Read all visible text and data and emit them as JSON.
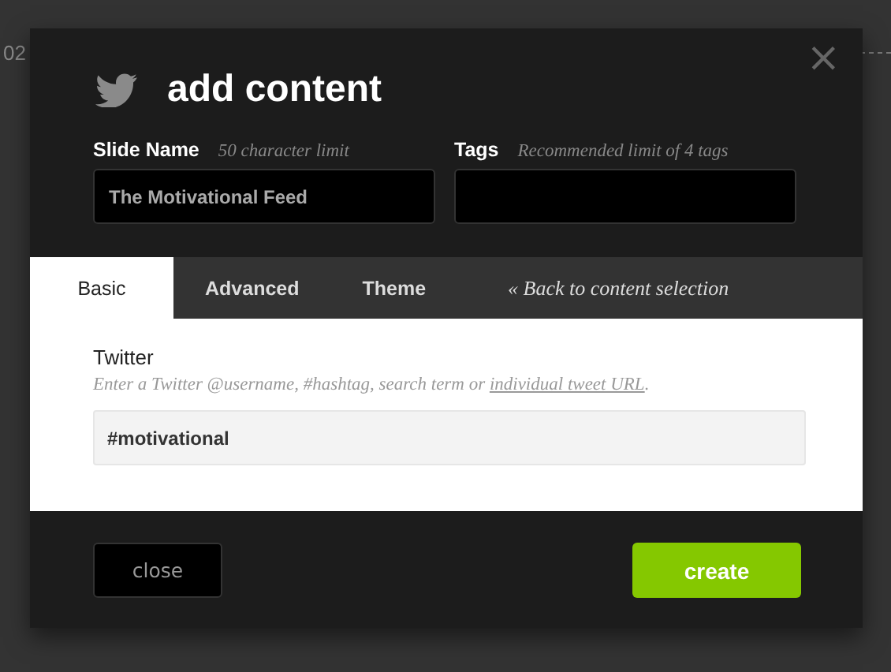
{
  "background_text": "02",
  "dialog": {
    "title": "add content",
    "close_glyph": "×",
    "fields": [
      {
        "label": "Slide Name",
        "hint": "50 character limit",
        "value": "The Motivational Feed"
      },
      {
        "label": "Tags",
        "hint": "Recommended limit of 4 tags"
      }
    ],
    "tabs": [
      {
        "label": "Basic",
        "selected": true,
        "kind": "tab"
      },
      {
        "label": "Advanced",
        "selected": false,
        "kind": "tab"
      },
      {
        "label": "Theme",
        "selected": false,
        "kind": "tab"
      },
      {
        "label": "« Back to content selection",
        "selected": false,
        "kind": "link"
      }
    ],
    "twitter": {
      "label": "Twitter",
      "hint_before": "Enter a Twitter @username, #hashtag, search term or ",
      "hint_link": "individual tweet URL",
      "hint_after": ".",
      "value": "#motivational"
    },
    "buttons": {
      "close": "close",
      "create": "create"
    }
  }
}
